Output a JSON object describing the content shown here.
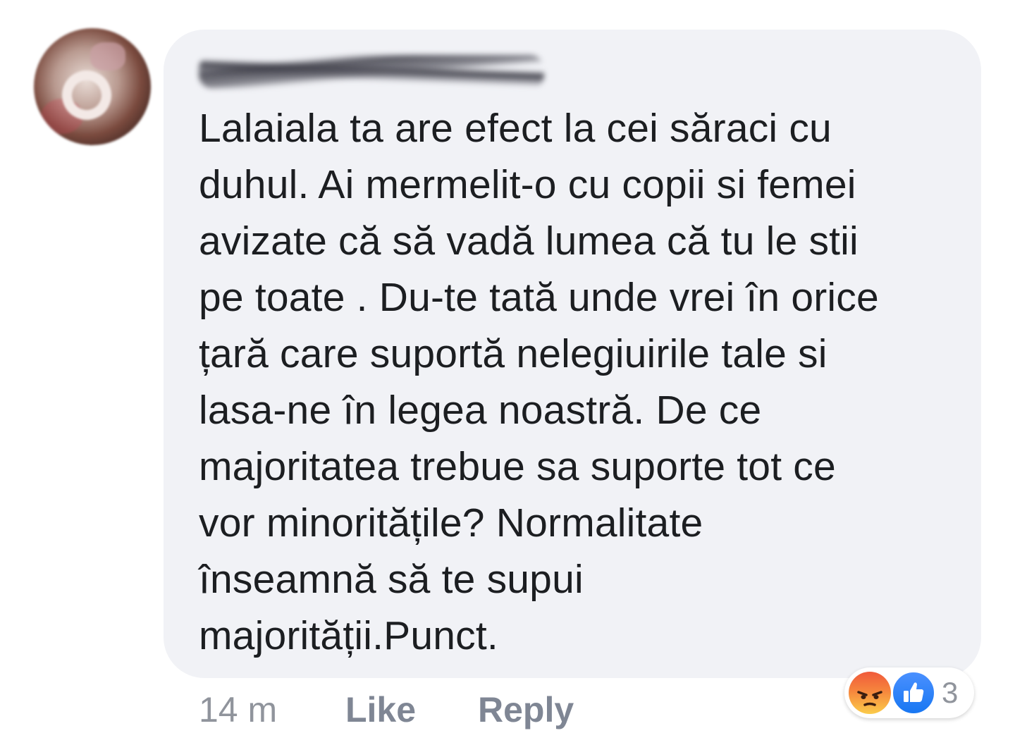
{
  "comment": {
    "author_name": "",
    "text_lines": [
      "Lalaiala ta are efect la cei săraci cu",
      "duhul. Ai mermelit-o cu copii si femei",
      "avizate că să vadă lumea că tu le stii",
      "pe toate . Du-te tată unde vrei în orice",
      "țară care suportă nelegiuirile tale si",
      "lasa-ne în legea noastră. De ce",
      "majoritatea trebue sa suporte tot ce",
      "vor minoritățile? Normalitate",
      "înseamnă să te supui",
      "majorității.Punct."
    ],
    "timestamp": "14 m",
    "like_label": "Like",
    "reply_label": "Reply",
    "reactions": {
      "icons": [
        "angry-icon",
        "like-icon"
      ],
      "count": "3",
      "colors": {
        "like": "#1877f2",
        "angry": "#f05a3b"
      }
    }
  },
  "colors": {
    "bubble_bg": "#f1f2f6",
    "text": "#1c1e21",
    "meta_text": "#90949c",
    "link_text": "#7f8694"
  }
}
